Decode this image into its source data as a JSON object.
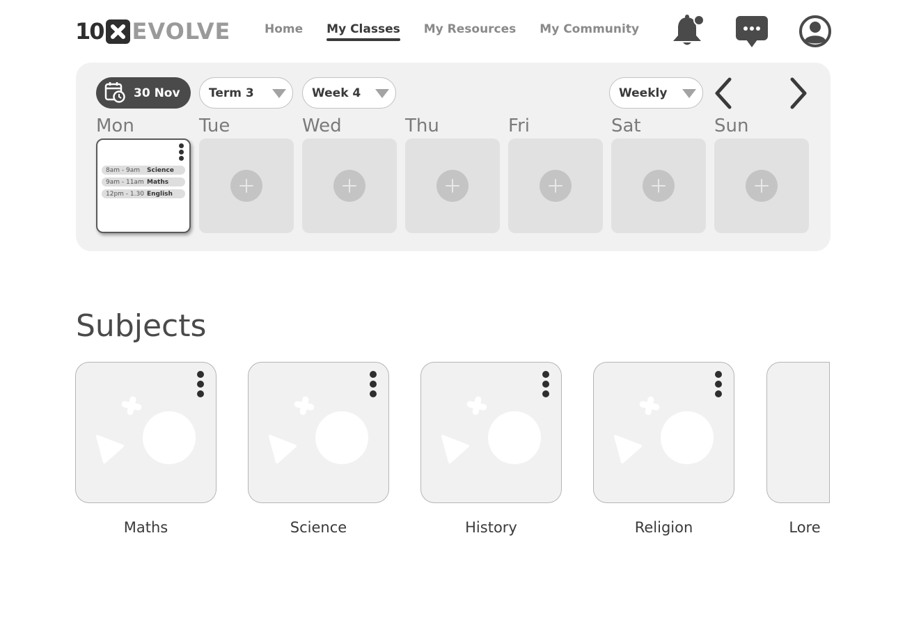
{
  "header": {
    "logo": {
      "part1": "10",
      "part2": "EVOLVE"
    },
    "nav": [
      {
        "label": "Home",
        "active": false
      },
      {
        "label": "My Classes",
        "active": true
      },
      {
        "label": "My Resources",
        "active": false
      },
      {
        "label": "My Community",
        "active": false
      }
    ],
    "icons": [
      "bell-icon",
      "chat-icon",
      "user-icon"
    ],
    "notification_dot": true
  },
  "calendar": {
    "date": "30 Nov",
    "term": "Term 3",
    "week": "Week 4",
    "view": "Weekly",
    "days": [
      {
        "label": "Mon",
        "today": true,
        "classes": [
          {
            "time": "8am - 9am",
            "subject": "Science"
          },
          {
            "time": "9am - 11am",
            "subject": "Maths"
          },
          {
            "time": "12pm - 1.30",
            "subject": "English"
          }
        ]
      },
      {
        "label": "Tue",
        "today": false,
        "classes": []
      },
      {
        "label": "Wed",
        "today": false,
        "classes": []
      },
      {
        "label": "Thu",
        "today": false,
        "classes": []
      },
      {
        "label": "Fri",
        "today": false,
        "classes": []
      },
      {
        "label": "Sat",
        "today": false,
        "classes": []
      },
      {
        "label": "Sun",
        "today": false,
        "classes": []
      }
    ]
  },
  "subjects": {
    "title": "Subjects",
    "items": [
      {
        "label": "Maths"
      },
      {
        "label": "Science"
      },
      {
        "label": "History"
      },
      {
        "label": "Religion"
      },
      {
        "label": "Lore"
      }
    ]
  },
  "colors": {
    "text_dark": "#3a3a3a",
    "text_muted": "#8a8a8a",
    "panel_bg": "#f1f1f1",
    "card_bg": "#e1e1e1",
    "pill_dark": "#4a4a4a"
  }
}
